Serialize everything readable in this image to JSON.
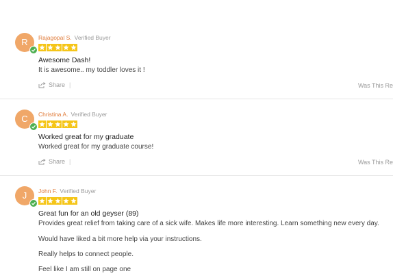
{
  "verified_label": "Verified Buyer",
  "share_label": "Share",
  "helpful_label": "Was This Rev",
  "colors": {
    "accent": "#e07b39",
    "avatar": "#f0a768",
    "star": "#f5c518",
    "verified": "#4caf50"
  },
  "reviews": [
    {
      "initial": "R",
      "author": "Rajagopal S.",
      "rating": 5,
      "title": "Awesome Dash!",
      "lines": [
        "It is awesome.. my toddler loves it !"
      ]
    },
    {
      "initial": "C",
      "author": "Christina A.",
      "rating": 5,
      "title": "Worked great for my graduate",
      "lines": [
        "Worked great for my graduate course!"
      ]
    },
    {
      "initial": "J",
      "author": "John F.",
      "rating": 5,
      "title": "Great fun for an old geyser (89)",
      "lines": [
        "Provides great relief from taking care of a sick wife. Makes life more interesting. Learn something new every day.",
        "Would have liked a bit more help via your instructions.",
        "Really helps to connect people.",
        "Feel like I am still on page one"
      ]
    }
  ]
}
